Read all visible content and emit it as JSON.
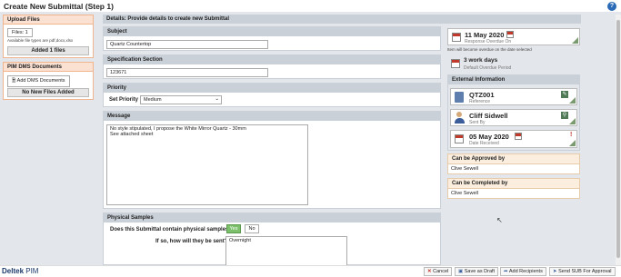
{
  "window": {
    "title": "Create New Submittal (Step 1)",
    "help_icon": "?"
  },
  "left": {
    "upload": {
      "header": "Upload Files",
      "files_button": "Files: 1",
      "hint": "Available file types are pdf,docx,xlsx",
      "added": "Added 1 files"
    },
    "pim": {
      "header": "PIM DMS Documents",
      "add_button": "Add DMS Documents",
      "no_files": "No New Files Added"
    }
  },
  "main": {
    "header": "Details: Provide details to create new Submittal",
    "subject": {
      "label": "Subject",
      "value": "Quartz Countertop"
    },
    "spec": {
      "label": "Specification Section",
      "value": "123671"
    },
    "priority": {
      "label": "Priority",
      "set_label": "Set Priority",
      "value": "Medium"
    },
    "message": {
      "label": "Message",
      "line1": "No style stipulated, I propose the White Mirror Quartz - 30mm",
      "line2": "See attached sheet"
    },
    "physical": {
      "label": "Physical Samples",
      "question": "Does this Submittal contain physical samples?",
      "yes": "Yes",
      "no": "No",
      "how_label": "If so, how will they be sent?",
      "how_value": "Overnight"
    }
  },
  "right": {
    "response": {
      "date": "11 May 2020",
      "label": "Response Overdue On",
      "note": "Item will become overdue on the date selected"
    },
    "period": {
      "value": "3 work days",
      "label": "Default Overdue Period"
    },
    "external": {
      "header": "External Information",
      "reference": {
        "value": "QTZ001",
        "label": "Reference"
      },
      "sent_by": {
        "value": "Cliff Sidwell",
        "label": "Sent By"
      },
      "received": {
        "value": "05 May 2020",
        "label": "Date Received"
      }
    },
    "approved": {
      "header": "Can be Approved by",
      "value": "Clive Sewell"
    },
    "completed": {
      "header": "Can be Completed by",
      "value": "Clive Sewell"
    }
  },
  "footer": {
    "brand": "Deltek",
    "brand_suffix": "PIM",
    "cancel": "Cancel",
    "save": "Save as Draft",
    "add_recipients": "Add Recipients",
    "send": "Send SUB For Approval"
  }
}
